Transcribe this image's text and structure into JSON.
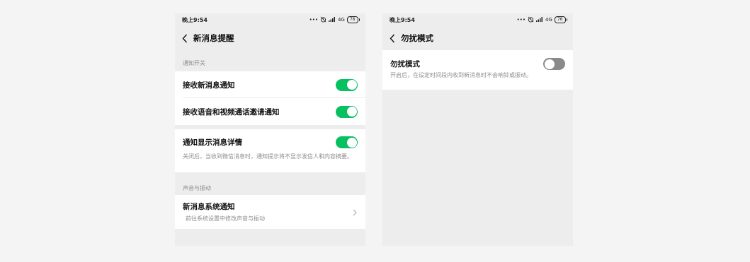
{
  "left": {
    "status": {
      "time": "晚上9:54",
      "network": "4G",
      "battery": "76"
    },
    "nav": {
      "title": "新消息提醒"
    },
    "section_notification": {
      "header": "通知开关"
    },
    "rows": {
      "receive": {
        "label": "接收新消息通知",
        "toggle": "on"
      },
      "voice_video": {
        "label": "接收语音和视频通话邀请通知",
        "toggle": "on"
      },
      "detail": {
        "label": "通知显示消息详情",
        "toggle": "on",
        "description": "关闭后，当收到微信消息时，通知提示将不显示发信人和内容摘要。"
      }
    },
    "section_sound": {
      "header": "声音与振动"
    },
    "system_notify": {
      "label": "新消息系统通知",
      "description": "前往系统设置中修改声音与振动"
    }
  },
  "right": {
    "status": {
      "time": "晚上9:54",
      "network": "4G",
      "battery": "76"
    },
    "nav": {
      "title": "勿扰模式"
    },
    "dnd": {
      "label": "勿扰模式",
      "toggle": "off",
      "description": "开启后，在设定时间段内收到新消息时不会响铃或振动。"
    }
  },
  "colors": {
    "toggle_on": "#07c160",
    "toggle_off": "#8a8a8a",
    "page_bg": "#ededed",
    "card_bg": "#ffffff"
  },
  "icons": [
    "back-icon",
    "chevron-right-icon",
    "signal-icon",
    "alarm-icon",
    "battery-icon"
  ]
}
